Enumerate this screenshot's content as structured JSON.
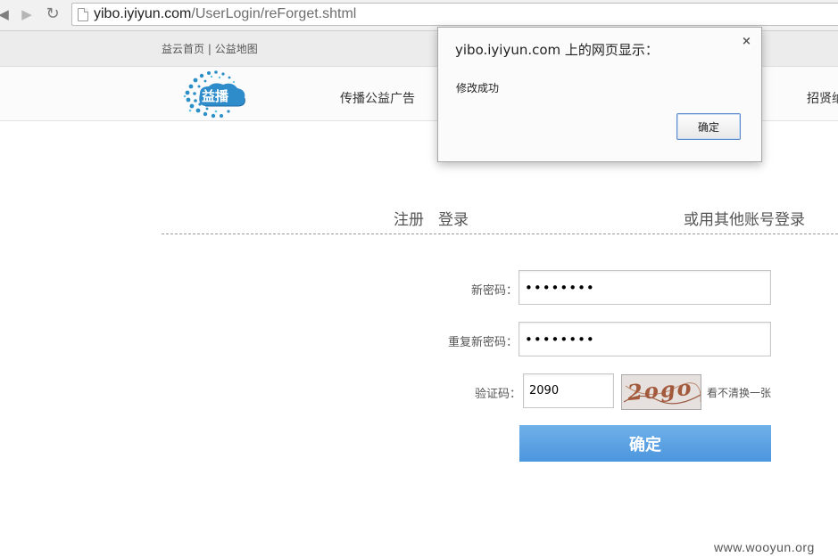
{
  "browser": {
    "url_host": "yibo.iyiyun.com",
    "url_path": "/UserLogin/reForget.shtml",
    "back_icon": "back-arrow-icon",
    "forward_icon": "forward-arrow-icon",
    "reload_icon": "reload-icon"
  },
  "topbar": {
    "link_home": "益云首页",
    "separator": "|",
    "link_map": "公益地图"
  },
  "nav": {
    "logo_text": "益播",
    "items": [
      "传播公益广告",
      "招贤纳"
    ]
  },
  "login_header": {
    "register": "注册",
    "login": "登录",
    "other_login": "或用其他账号登录"
  },
  "form": {
    "new_password_label": "新密码：",
    "new_password_value": "••••••••",
    "repeat_password_label": "重复新密码：",
    "repeat_password_value": "••••••••",
    "captcha_label": "验证码：",
    "captcha_value": "2090",
    "captcha_image_text": "2ogo",
    "refresh_captcha": "看不清换一张",
    "submit_label": "确定"
  },
  "dialog": {
    "title": "yibo.iyiyun.com 上的网页显示：",
    "close": "×",
    "message": "修改成功",
    "ok_label": "确定"
  },
  "watermark": "www.wooyun.org",
  "colors": {
    "accent_blue": "#5aa2e4",
    "dialog_button_border": "#5d89c9",
    "captcha_text": "#a35a3c"
  }
}
